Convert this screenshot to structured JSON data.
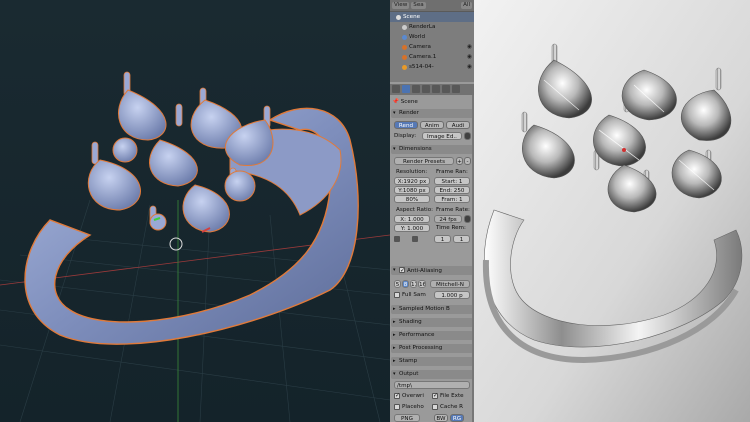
{
  "outliner": {
    "header": {
      "view": "View",
      "search": "Sea",
      "filter": "All"
    },
    "items": [
      {
        "label": "Scene",
        "indent": 0
      },
      {
        "label": "RenderLa",
        "indent": 1
      },
      {
        "label": "World",
        "indent": 1
      },
      {
        "label": "Camera",
        "indent": 1
      },
      {
        "label": "Camera.1",
        "indent": 1
      },
      {
        "label": "s514-04-",
        "indent": 1
      }
    ]
  },
  "properties": {
    "breadcrumb": "Scene",
    "render": {
      "section": "Render",
      "buttons": [
        "Rend",
        "Anim",
        "Audi"
      ],
      "display_label": "Display:",
      "display_value": "Image Ed.."
    },
    "dimensions": {
      "section": "Dimensions",
      "presets": "Render Presets",
      "resolution_label": "Resolution:",
      "res_x": "X:1920 px",
      "res_y": "Y:1080 px",
      "res_pct": "80%",
      "frame_range_label": "Frame Ran:",
      "start": "Start: 1",
      "end": "End: 250",
      "step": "Fram: 1",
      "aspect_label": "Aspect Ratio:",
      "aspect_x": "X: 1.000",
      "aspect_y": "Y: 1.000",
      "frame_rate_label": "Frame Rate:",
      "fps": "24 fps",
      "time_remap_label": "Time Rem:",
      "remap_old": "1",
      "remap_new": "1"
    },
    "anti_aliasing": {
      "section": "Anti-Aliasing",
      "samples": [
        "5",
        "8",
        "11",
        "16"
      ],
      "filter": "Mitchell-N",
      "full_sample": "Full Sam",
      "size": "1.000 p"
    },
    "sampled_motion_blur": "Sampled Motion B",
    "shading": "Shading",
    "performance": "Performance",
    "post_processing": "Post Processing",
    "stamp": "Stamp",
    "output": {
      "section": "Output",
      "path": "/tmp\\",
      "overwrite": "Overwri",
      "file_ext": "File Exte",
      "placeholders": "Placeho",
      "cache_result": "Cache R",
      "format": "PNG",
      "bw": "BW",
      "rgb": "RG"
    }
  }
}
